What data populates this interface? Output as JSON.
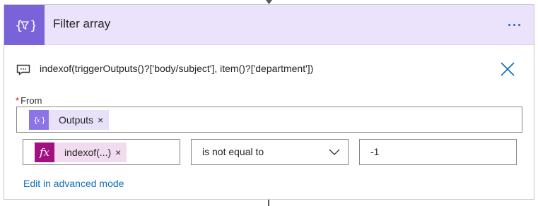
{
  "card": {
    "title": "Filter array",
    "icon": "filter-array-icon",
    "accent_color": "#7a62d8",
    "header_color": "#ebe3fb",
    "more_icon": "ellipsis-icon"
  },
  "expression": {
    "icon": "comment-icon",
    "text": "indexof(triggerOutputs()?['body/subject'], item()?['department'])",
    "close_icon": "close-icon"
  },
  "from": {
    "label": "From",
    "required_marker": "*",
    "token": {
      "label": "Outputs",
      "remove": "×",
      "icon": "variable-icon"
    }
  },
  "condition": {
    "left_token": {
      "icon_text": "fx",
      "label": "indexof(...)",
      "remove": "×"
    },
    "operator": "is not equal to",
    "value": "-1"
  },
  "advanced_link": "Edit in advanced mode",
  "colors": {
    "link": "#0f6cbd",
    "fx_token": "#a2117f",
    "variable_token": "#8c74e6"
  }
}
